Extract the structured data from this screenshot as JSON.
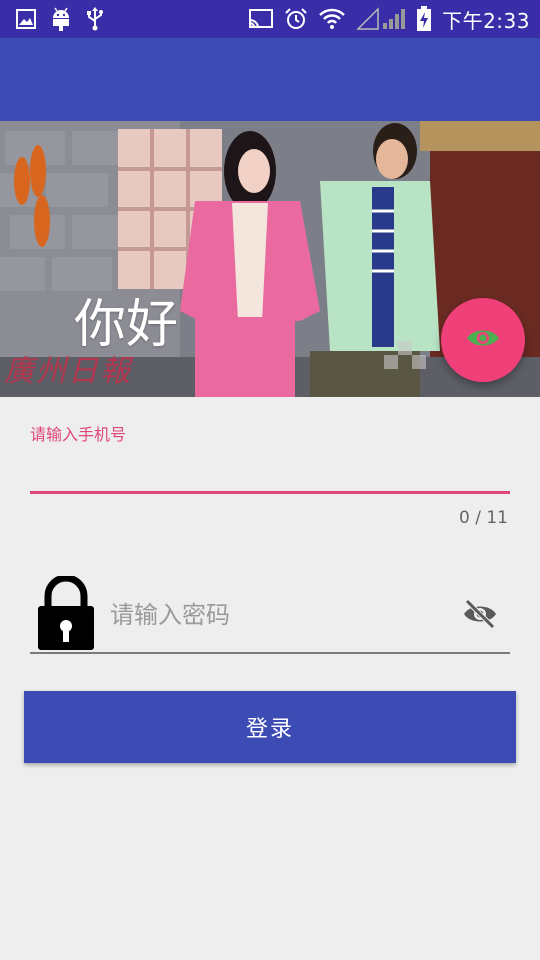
{
  "status_bar": {
    "time": "下午2:33",
    "left_icons": [
      "image-icon",
      "android-icon",
      "usb-icon"
    ],
    "right_icons": [
      "cast-icon",
      "alarm-icon",
      "wifi-icon",
      "signal-icon",
      "battery-icon"
    ]
  },
  "hero": {
    "title": "你好",
    "watermark": "廣州日報"
  },
  "fab": {
    "icon": "eye-icon",
    "color": "#f0407a",
    "icon_color": "#4caf50"
  },
  "phone": {
    "label": "请输入手机号",
    "value": "",
    "counter": "0 / 11",
    "accent": "#e0457a"
  },
  "password": {
    "placeholder": "请输入密码",
    "lock_icon": "lock-icon",
    "toggle_icon": "eye-off-icon"
  },
  "login": {
    "label": "登录"
  },
  "colors": {
    "status_bar": "#3a2ea8",
    "app_bar": "#3c4cb4",
    "background": "#eeeeee",
    "primary": "#3c4cb4"
  }
}
